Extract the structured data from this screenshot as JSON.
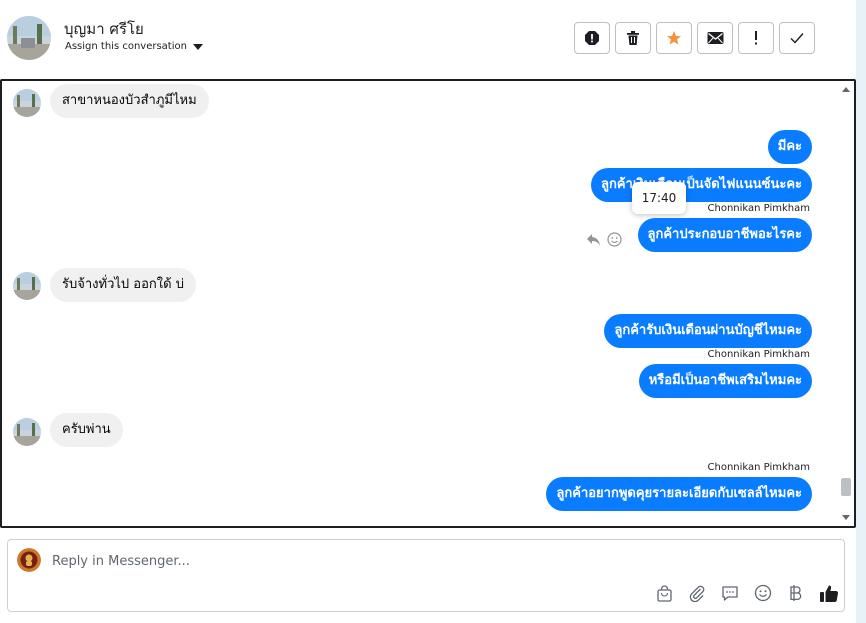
{
  "header": {
    "contact_name": "บุญมา ศรีโย",
    "assign_label": "Assign this conversation",
    "actions": [
      {
        "name": "spam-icon"
      },
      {
        "name": "trash-icon"
      },
      {
        "name": "star-icon",
        "color": "#f7923b"
      },
      {
        "name": "envelope-icon"
      },
      {
        "name": "exclamation-icon"
      },
      {
        "name": "checkmark-icon"
      }
    ]
  },
  "conversation": {
    "messages": [
      {
        "direction": "in",
        "text": "สาขาหนองบัวสำภูมีไหม"
      },
      {
        "direction": "out",
        "text": "มีคะ"
      },
      {
        "direction": "out",
        "text": "ลูกค้าเงินเดือนเป็นจัดไฟแนนซ์นะคะ"
      },
      {
        "direction": "out",
        "sender": "Chonnikan Pimkham",
        "text": "ลูกค้าประกอบอาชีพอะไรคะ"
      },
      {
        "direction": "in",
        "text": "รับจ้างทั่วไป ออกใด้ บ่"
      },
      {
        "direction": "out",
        "text": "ลูกค้ารับเงินเดือนผ่านบัญชีไหมคะ"
      },
      {
        "direction": "out",
        "sender": "Chonnikan Pimkham",
        "text": "หรือมีเป็นอาชีพเสริมไหมคะ"
      },
      {
        "direction": "in",
        "text": "ครับพ่าน"
      },
      {
        "direction": "out",
        "sender": "Chonnikan Pimkham",
        "text": "ลูกค้าอยากพูดคุยรายละเอียดกับเซลล์ไหมคะ"
      }
    ],
    "tooltip_time": "17:40",
    "accent_color": "#0a7cff"
  },
  "composer": {
    "placeholder": "Reply in Messenger...",
    "tools": [
      "bag-icon",
      "paperclip-icon",
      "saved-reply-icon",
      "emoji-icon",
      "baht-icon",
      "thumbs-up-icon"
    ]
  }
}
